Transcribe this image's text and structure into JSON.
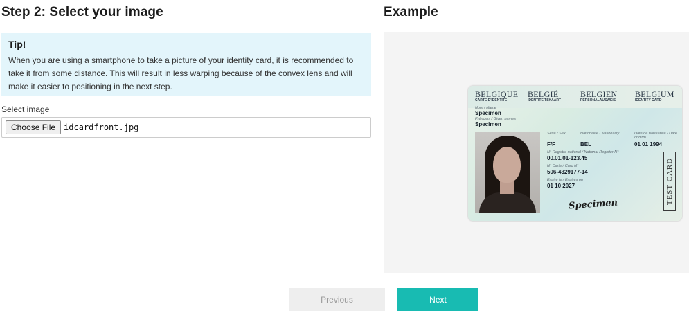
{
  "step": {
    "title": "Step 2: Select your image"
  },
  "example": {
    "title": "Example"
  },
  "tip": {
    "title": "Tip!",
    "body": "When you are using a smartphone to take a picture of your identity card, it is recommended to take it from some distance. This will result in less warping because of the convex lens and will make it easier to positioning in the next step."
  },
  "file_select": {
    "label": "Select image",
    "button_label": "Choose File",
    "file_name": "idcardfront.jpg"
  },
  "id_card": {
    "countries": [
      "BELGIQUE",
      "BELGIË",
      "BELGIEN",
      "BELGIUM"
    ],
    "subtitles": [
      "CARTE D'IDENTITE",
      "IDENTITEITSKAART",
      "PERSONALAUSWEIS",
      "IDENTITY CARD"
    ],
    "name_label": "Nom / Name",
    "name_value": "Specimen",
    "given_label": "Prénoms / Given names",
    "given_value": "Specimen",
    "sex_label": "Sexe / Sex",
    "sex_value": "F/F",
    "nationality_label": "Nationalité / Nationality",
    "nationality_value": "BEL",
    "dob_label": "Date de naissance / Date of birth",
    "dob_value": "01 01 1994",
    "national_register_label": "N° Registre national / National Register N°",
    "national_register_value": "00.01.01-123.45",
    "card_no_label": "N° Carte / Card N°",
    "card_no_value": "506-4329177-14",
    "expiry_label": "Expire le / Expires on",
    "expiry_value": "01 10 2027",
    "test_stamp": "TEST CARD",
    "signature": "Specimen"
  },
  "navigation": {
    "previous_label": "Previous",
    "next_label": "Next"
  },
  "colors": {
    "tip_background": "#e3f5fb",
    "next_button": "#18bbb2",
    "previous_button": "#eeeeee"
  }
}
